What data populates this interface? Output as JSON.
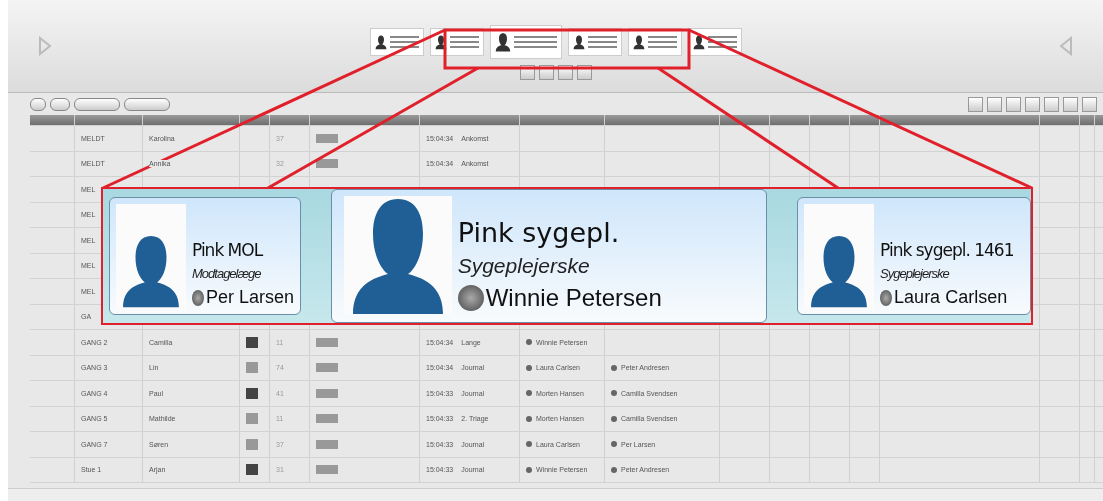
{
  "top_strip": {
    "cards": [
      {
        "selected": false
      },
      {
        "selected": false
      },
      {
        "selected": true
      },
      {
        "selected": false
      },
      {
        "selected": false
      },
      {
        "selected": false
      }
    ]
  },
  "table": {
    "rows": [
      {
        "code": "MELDT",
        "name": "Karolina",
        "number": "37",
        "time": "15:04:34",
        "status": "Ankomst",
        "persons": []
      },
      {
        "code": "MELDT",
        "name": "Annika",
        "number": "32",
        "time": "15:04:34",
        "status": "Ankomst",
        "persons": []
      },
      {
        "code": "MEL"
      },
      {
        "code": "MEL"
      },
      {
        "code": "MEL"
      },
      {
        "code": "MEL"
      },
      {
        "code": "MEL"
      },
      {
        "code": "GA"
      },
      {
        "code": "GANG 2",
        "name": "Camilla",
        "flag_dark": true,
        "number": "11",
        "time": "15:04:34",
        "status": "Lange",
        "persons": [
          "Winnie Petersen"
        ]
      },
      {
        "code": "GANG 3",
        "name": "Lin",
        "flag_dark": false,
        "number": "74",
        "time": "15:04:34",
        "status": "Journal",
        "persons": [
          "Laura Carlsen",
          "Peter Andresen"
        ]
      },
      {
        "code": "GANG 4",
        "name": "Paul",
        "flag_dark": true,
        "number": "41",
        "time": "15:04:33",
        "status": "Journal",
        "persons": [
          "Morten Hansen",
          "Camilla Svendsen"
        ]
      },
      {
        "code": "GANG 5",
        "name": "Mathilde",
        "flag_dark": false,
        "number": "11",
        "time": "15:04:33",
        "status": "2. Triage",
        "persons": [
          "Morten Hansen",
          "Camilla Svendsen"
        ]
      },
      {
        "code": "GANG 7",
        "name": "Søren",
        "flag_dark": false,
        "number": "37",
        "time": "15:04:33",
        "status": "Journal",
        "persons": [
          "Laura Carlsen",
          "Per Larsen"
        ]
      },
      {
        "code": "Stue 1",
        "name": "Arjan",
        "flag_dark": true,
        "number": "31",
        "time": "15:04:33",
        "status": "Journal",
        "persons": [
          "Winnie Petersen",
          "Peter Andresen"
        ]
      }
    ]
  },
  "callout": {
    "cards": [
      {
        "kind": "small",
        "title": "Pink MOL",
        "role": "Modtagelæge",
        "person": "Per Larsen"
      },
      {
        "kind": "large",
        "title": "Pink sygepl.",
        "role": "Sygeplejerske",
        "person": "Winnie Petersen"
      },
      {
        "kind": "small",
        "title": "Pink sygepl. 1461",
        "role": "Sygeplejerske",
        "person": "Laura Carlsen"
      }
    ]
  }
}
